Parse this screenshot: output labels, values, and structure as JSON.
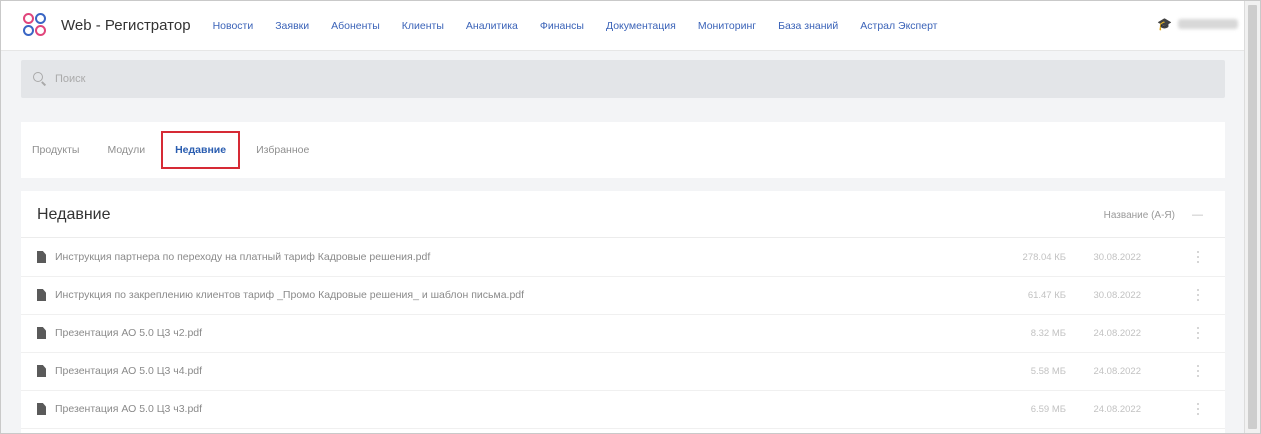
{
  "app": {
    "title": "Web - Регистратор",
    "logo_icon": "logo-icon"
  },
  "nav": {
    "items": [
      {
        "label": "Новости"
      },
      {
        "label": "Заявки"
      },
      {
        "label": "Абоненты"
      },
      {
        "label": "Клиенты"
      },
      {
        "label": "Аналитика"
      },
      {
        "label": "Финансы"
      },
      {
        "label": "Документация"
      },
      {
        "label": "Мониторинг"
      },
      {
        "label": "База знаний"
      },
      {
        "label": "Астрал Эксперт"
      }
    ],
    "user_icon": "graduation-cap-icon",
    "accent_color": "#3b63b8"
  },
  "search": {
    "placeholder": "Поиск"
  },
  "tabs": {
    "items": [
      {
        "label": "Продукты"
      },
      {
        "label": "Модули"
      },
      {
        "label": "Недавние"
      },
      {
        "label": "Избранное"
      }
    ],
    "active": "Недавние",
    "highlight_color": "#d62a35"
  },
  "recent": {
    "title": "Недавние",
    "sort_label": "Название (А-Я)",
    "sort_extra": "—",
    "files": [
      {
        "name": "Инструкция партнера по переходу на платный тариф Кадровые решения.pdf",
        "size": "278.04 КБ",
        "date": "30.08.2022"
      },
      {
        "name": "Инструкция по закреплению клиентов тариф _Промо Кадровые решения_ и шаблон письма.pdf",
        "size": "61.47 КБ",
        "date": "30.08.2022"
      },
      {
        "name": "Презентация АО 5.0 Ц3 ч2.pdf",
        "size": "8.32 МБ",
        "date": "24.08.2022"
      },
      {
        "name": "Презентация АО 5.0 Ц3 ч4.pdf",
        "size": "5.58 МБ",
        "date": "24.08.2022"
      },
      {
        "name": "Презентация АО 5.0 Ц3 ч3.pdf",
        "size": "6.59 МБ",
        "date": "24.08.2022"
      }
    ]
  }
}
